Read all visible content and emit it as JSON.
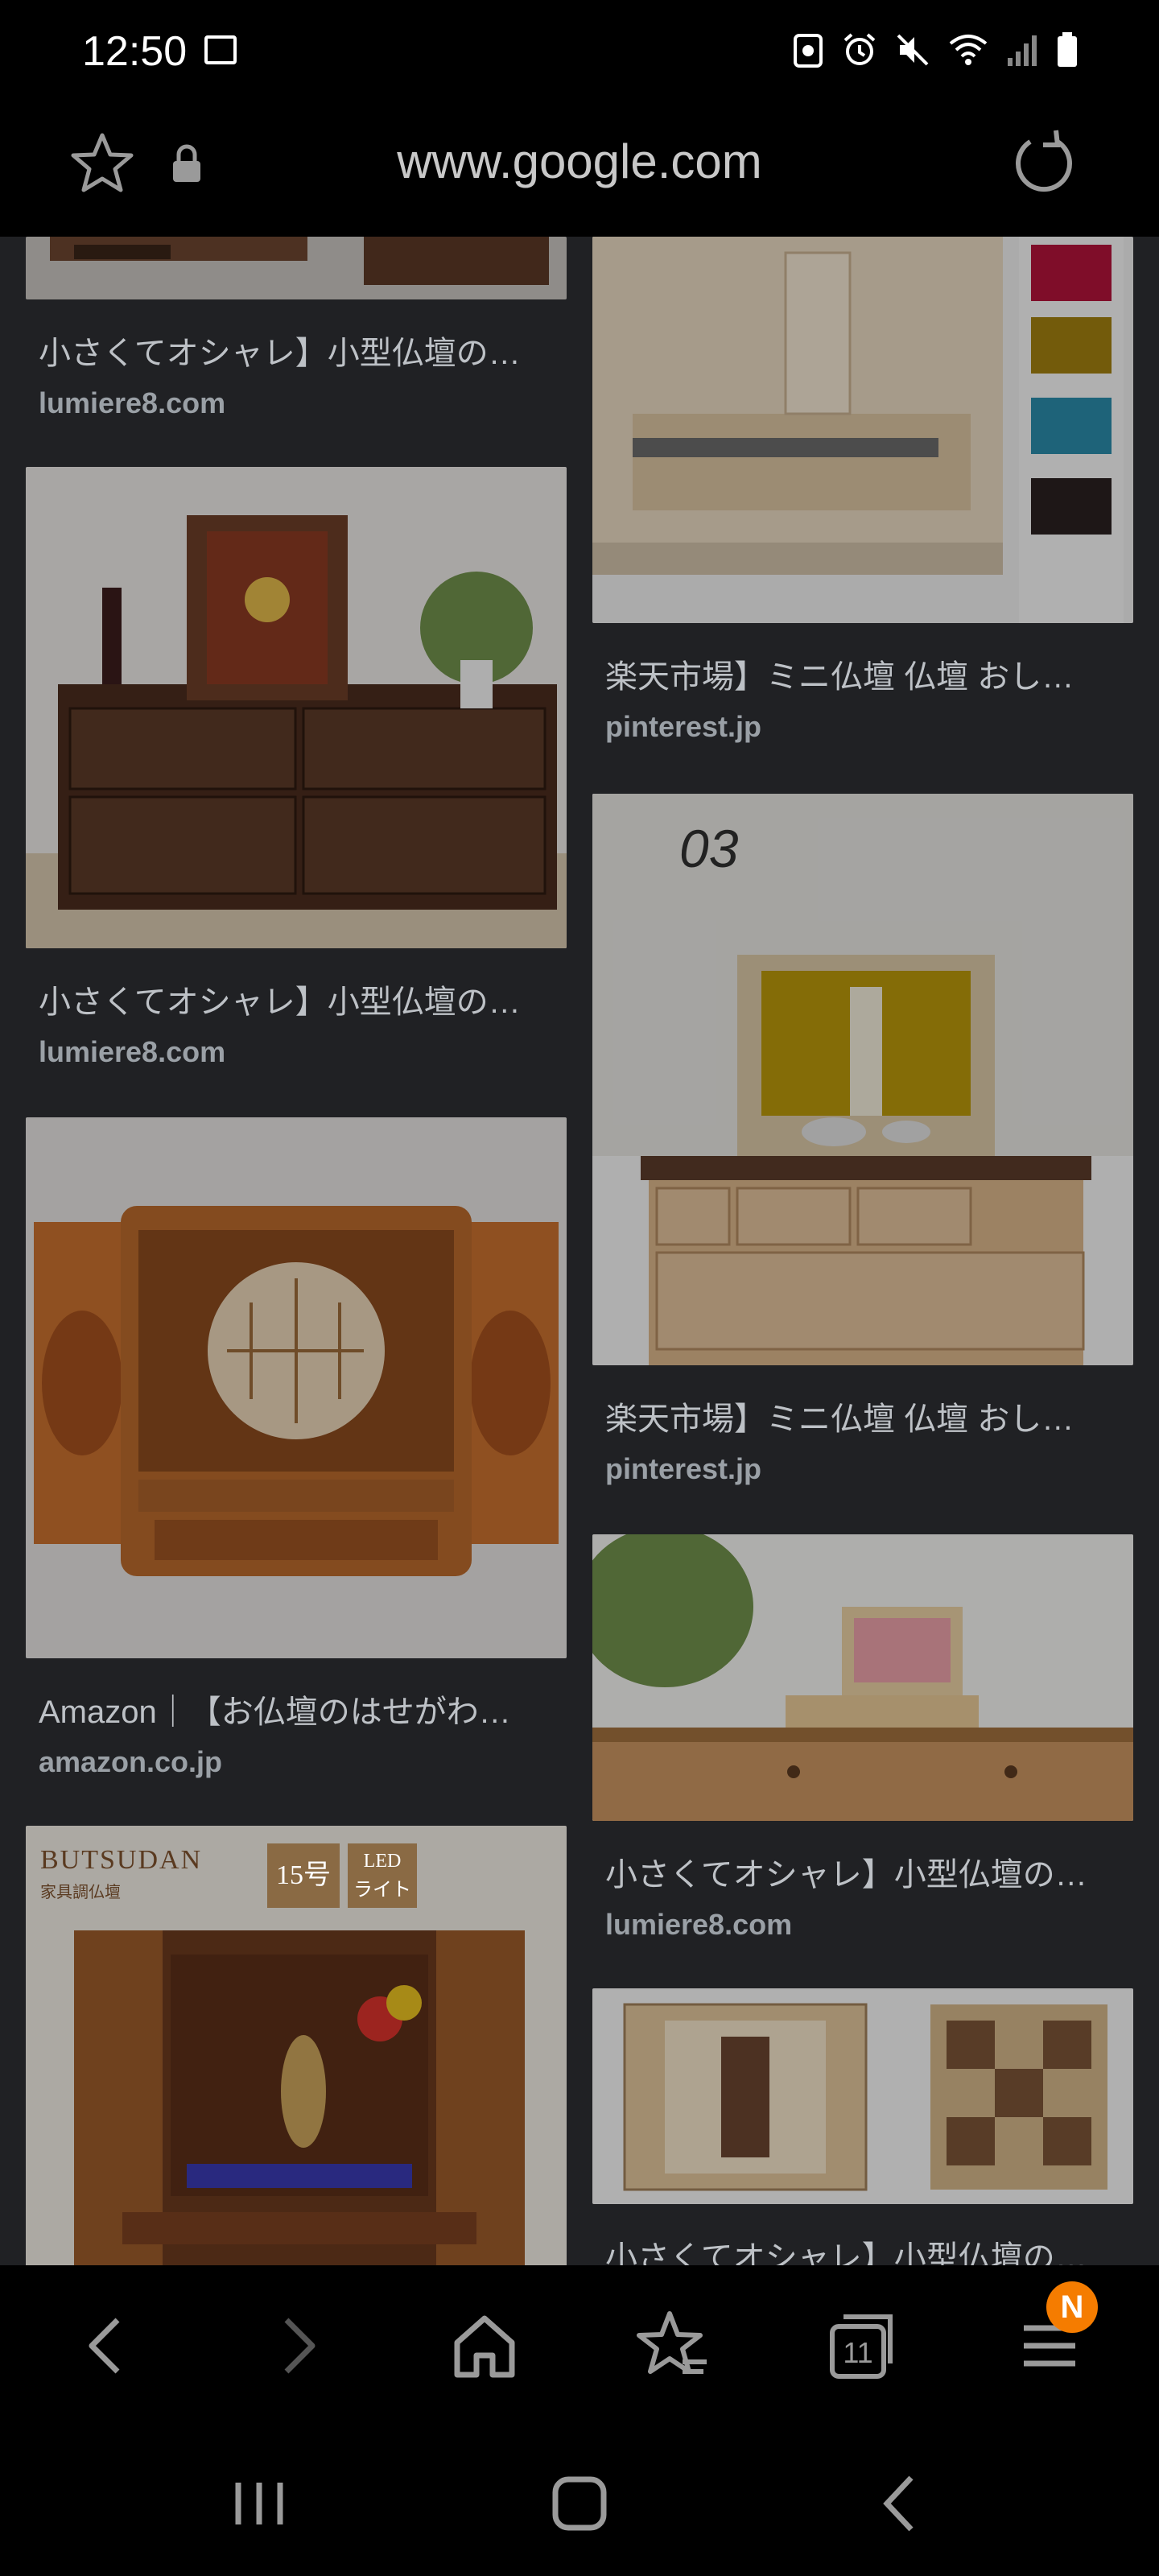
{
  "status": {
    "time": "12:50"
  },
  "browser": {
    "url": "www.google.com",
    "tab_count": "11",
    "menu_badge": "N"
  },
  "results": {
    "left": [
      {
        "title": "小さくてオシャレ】小型仏壇の…",
        "source": "lumiere8.com"
      },
      {
        "title": "小さくてオシャレ】小型仏壇の…",
        "source": "lumiere8.com"
      },
      {
        "title": "Amazon｜【お仏壇のはせがわ…",
        "source": "amazon.co.jp"
      },
      {
        "banner_lines": [
          "BUTSUDAN",
          "家具調仏壇"
        ],
        "badge_size": "15号",
        "badge_led": [
          "LED",
          "ライト"
        ]
      }
    ],
    "right": [
      {
        "title": "楽天市場】ミニ仏壇 仏壇 おし…",
        "source": "pinterest.jp"
      },
      {
        "title": "楽天市場】ミニ仏壇 仏壇 おし…",
        "source": "pinterest.jp",
        "image_label": "03"
      },
      {
        "title": "小さくてオシャレ】小型仏壇の…",
        "source": "lumiere8.com"
      },
      {
        "title": "小さくてオシャレ】小型仏壇の…"
      }
    ]
  }
}
